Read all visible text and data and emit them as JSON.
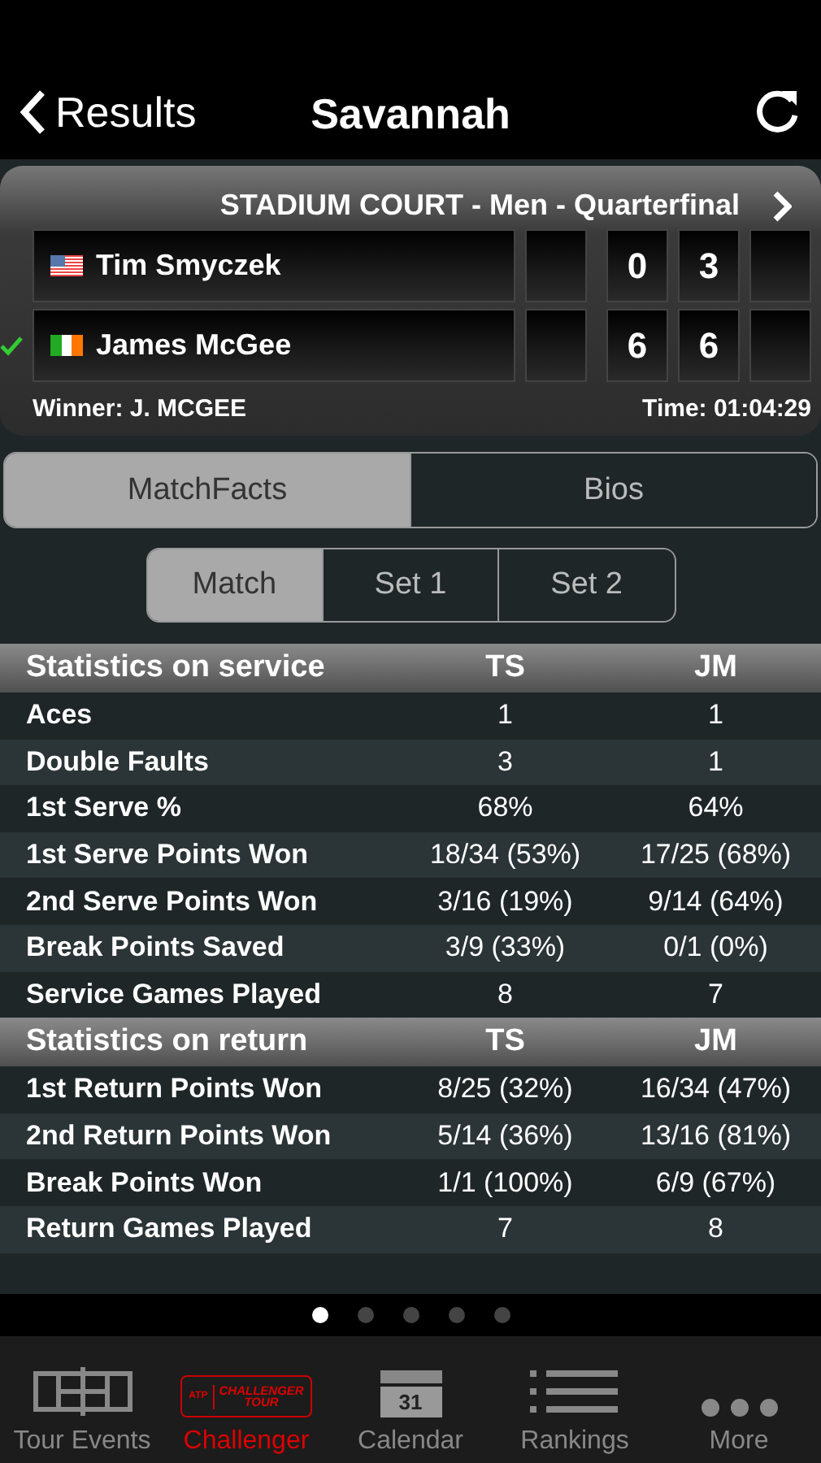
{
  "nav": {
    "back": "Results",
    "title": "Savannah"
  },
  "match": {
    "title": "STADIUM COURT - Men - Quarterfinal",
    "players": [
      {
        "name": "Tim Smyczek",
        "kind": "us",
        "winner": false,
        "sets": [
          "0",
          "3"
        ]
      },
      {
        "name": "James McGee",
        "kind": "ie",
        "winner": true,
        "sets": [
          "6",
          "6"
        ]
      }
    ],
    "winner": "Winner: J. MCGEE",
    "time": "Time: 01:04:29"
  },
  "tabs": [
    {
      "label": "MatchFacts",
      "selected": true
    },
    {
      "label": "Bios",
      "selected": false
    }
  ],
  "subtabs": [
    {
      "label": "Match",
      "selected": true
    },
    {
      "label": "Set 1",
      "selected": false
    },
    {
      "label": "Set 2",
      "selected": false
    }
  ],
  "sections": [
    {
      "title": "Statistics on service",
      "col1": "TS",
      "col2": "JM",
      "rows": [
        {
          "label": "Aces",
          "a": "1",
          "b": "1"
        },
        {
          "label": "Double Faults",
          "a": "3",
          "b": "1"
        },
        {
          "label": "1st Serve %",
          "a": "68%",
          "b": "64%"
        },
        {
          "label": "1st Serve Points Won",
          "a": "18/34 (53%)",
          "b": "17/25 (68%)"
        },
        {
          "label": "2nd Serve Points Won",
          "a": "3/16 (19%)",
          "b": "9/14 (64%)"
        },
        {
          "label": "Break Points Saved",
          "a": "3/9 (33%)",
          "b": "0/1 (0%)"
        },
        {
          "label": "Service Games Played",
          "a": "8",
          "b": "7"
        }
      ]
    },
    {
      "title": "Statistics on return",
      "col1": "TS",
      "col2": "JM",
      "rows": [
        {
          "label": "1st Return Points Won",
          "a": "8/25 (32%)",
          "b": "16/34 (47%)"
        },
        {
          "label": "2nd Return Points Won",
          "a": "5/14 (36%)",
          "b": "13/16 (81%)"
        },
        {
          "label": "Break Points Won",
          "a": "1/1 (100%)",
          "b": "6/9 (67%)"
        },
        {
          "label": "Return Games Played",
          "a": "7",
          "b": "8"
        }
      ]
    }
  ],
  "pages": [
    {
      "selected": true
    },
    {
      "selected": false
    },
    {
      "selected": false
    },
    {
      "selected": false
    },
    {
      "selected": false
    }
  ],
  "tabbar": [
    {
      "kind": "court",
      "label": "Tour Events",
      "selected": false
    },
    {
      "kind": "logo",
      "label": "Challenger",
      "logo_text": "CHALLENGER",
      "logo_sub": "TOUR",
      "logo_mark": "ATP",
      "selected": true
    },
    {
      "kind": "calendar",
      "label": "Calendar",
      "day": "31",
      "selected": false
    },
    {
      "kind": "list",
      "label": "Rankings",
      "selected": false
    },
    {
      "kind": "dots",
      "label": "More",
      "selected": false
    }
  ]
}
